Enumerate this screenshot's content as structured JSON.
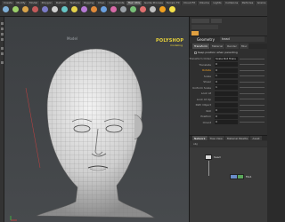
{
  "shelf": {
    "tabs": [
      "Create",
      "Modify",
      "Model",
      "Polygon",
      "Deform",
      "Texture",
      "Rigging",
      "Char.",
      "Constraints",
      "Hair Utils",
      "Guide Process",
      "Terrain FX",
      "Cloud FX",
      "Volume",
      "Lights",
      "Collisions",
      "Particles",
      "Grains"
    ],
    "active_tab_index": 9,
    "tools": [
      {
        "icon": "box-icon",
        "color": "#7fb0d8"
      },
      {
        "icon": "sphere-icon",
        "color": "#9bd06a"
      },
      {
        "icon": "tube-icon",
        "color": "#d9a44a"
      },
      {
        "icon": "torus-icon",
        "color": "#c45a5a"
      },
      {
        "icon": "grid-icon",
        "color": "#7c7cc8"
      },
      {
        "icon": "null-icon",
        "color": "#d0d0d0"
      },
      {
        "icon": "line-icon",
        "color": "#66c6c6"
      },
      {
        "icon": "circle-icon",
        "color": "#e6d34a"
      },
      {
        "icon": "curve-icon",
        "color": "#b77ad6"
      },
      {
        "icon": "draw-curve-icon",
        "color": "#e28b3a"
      },
      {
        "icon": "path-icon",
        "color": "#6aa0e0"
      },
      {
        "icon": "spray-paint-icon",
        "color": "#d86aa8"
      },
      {
        "icon": "platonic-icon",
        "color": "#9aa0a6"
      },
      {
        "icon": "l-system-icon",
        "color": "#78c078"
      },
      {
        "icon": "metaball-icon",
        "color": "#e07070"
      },
      {
        "icon": "file-icon",
        "color": "#c0c0c0"
      },
      {
        "icon": "font-icon",
        "color": "#f0a020"
      },
      {
        "icon": "lights-icon",
        "color": "#f4e04a"
      }
    ]
  },
  "viewport": {
    "title": "Model",
    "brand": "POLYSHOP",
    "brand_sub": "modeling"
  },
  "panel": {
    "title": "Geometry",
    "name": "head",
    "tabs": [
      "Transform",
      "Material",
      "Render",
      "Misc"
    ],
    "active_tab_index": 0,
    "checkbox_label": "Keep position when parenting",
    "params": [
      {
        "label": "Transform Order",
        "value": "Scale Rot Trans"
      },
      {
        "label": "Translate",
        "value": "0",
        "highlight": false
      },
      {
        "label": "Rotate",
        "value": "0",
        "highlight": true
      },
      {
        "label": "Scale",
        "value": "1"
      },
      {
        "label": "Shear",
        "value": "0"
      },
      {
        "label": "Uniform Scale",
        "value": "1"
      },
      {
        "label": "Look At",
        "value": ""
      },
      {
        "label": "Look At Up",
        "value": ""
      },
      {
        "label": "Path Object",
        "value": ""
      },
      {
        "label": "Roll",
        "value": "0"
      },
      {
        "label": "Position",
        "value": "0"
      },
      {
        "label": "Orient",
        "value": "0"
      }
    ],
    "accent": "#f0a020"
  },
  "network": {
    "tabs": [
      "Network",
      "Tree View",
      "Material Palette",
      "Asset"
    ],
    "active_tab_index": 0,
    "path": "obj",
    "nodes": [
      {
        "label": "head",
        "color": "#d8d8d8"
      },
      {
        "label": "file1",
        "color": "#6a8cc8"
      },
      {
        "label": "edit1",
        "color": "#5aa65a"
      }
    ]
  }
}
